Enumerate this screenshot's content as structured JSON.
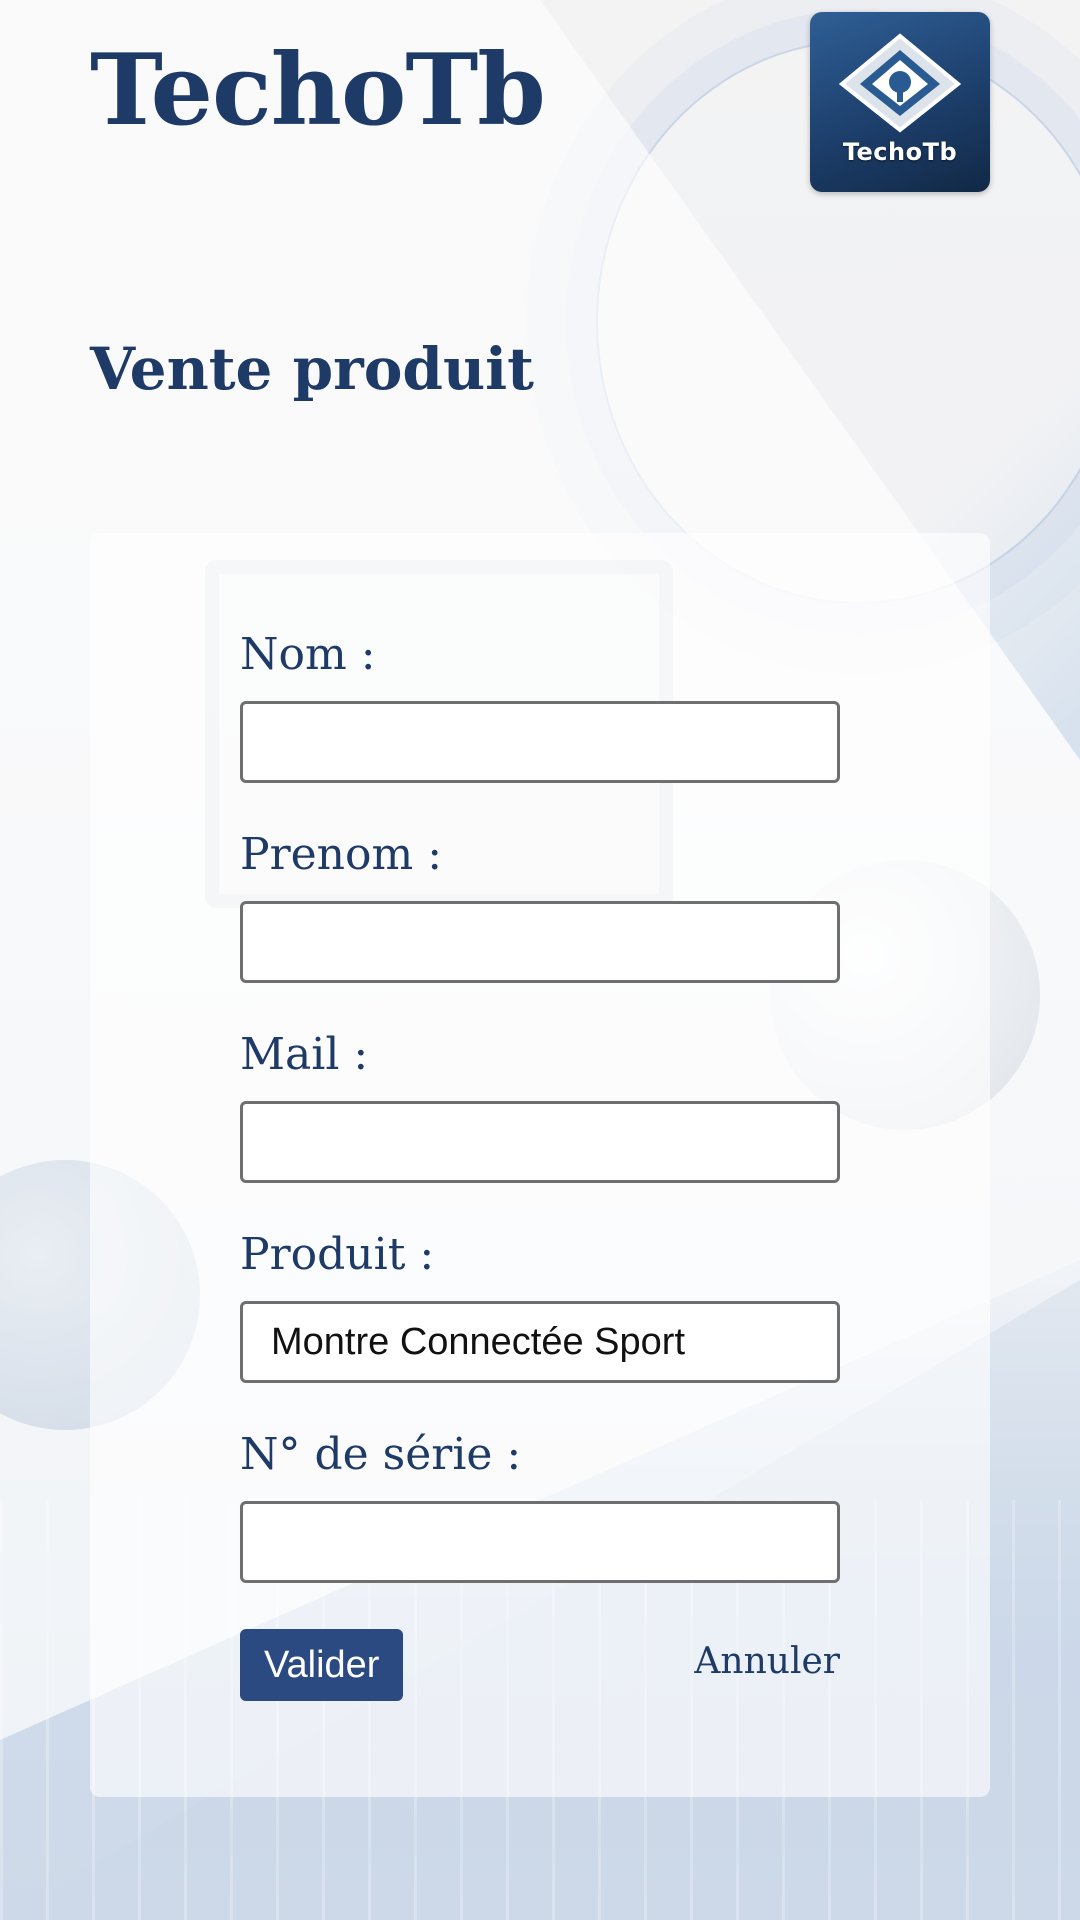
{
  "brand": {
    "name": "TechoTb",
    "logo_text": "TechoTb"
  },
  "page": {
    "title": "Vente produit"
  },
  "form": {
    "fields": [
      {
        "label": "Nom :",
        "value": "",
        "placeholder": ""
      },
      {
        "label": "Prenom :",
        "value": "",
        "placeholder": ""
      },
      {
        "label": "Mail :",
        "value": "",
        "placeholder": ""
      },
      {
        "label": "Produit :",
        "value": "Montre Connectée Sport",
        "placeholder": ""
      },
      {
        "label": "N° de série :",
        "value": "",
        "placeholder": ""
      }
    ],
    "submit_label": "Valider",
    "cancel_label": "Annuler"
  },
  "colors": {
    "primary": "#1e3a66",
    "button": "#2b4a82",
    "logo_bg": "#1d3f6c"
  }
}
